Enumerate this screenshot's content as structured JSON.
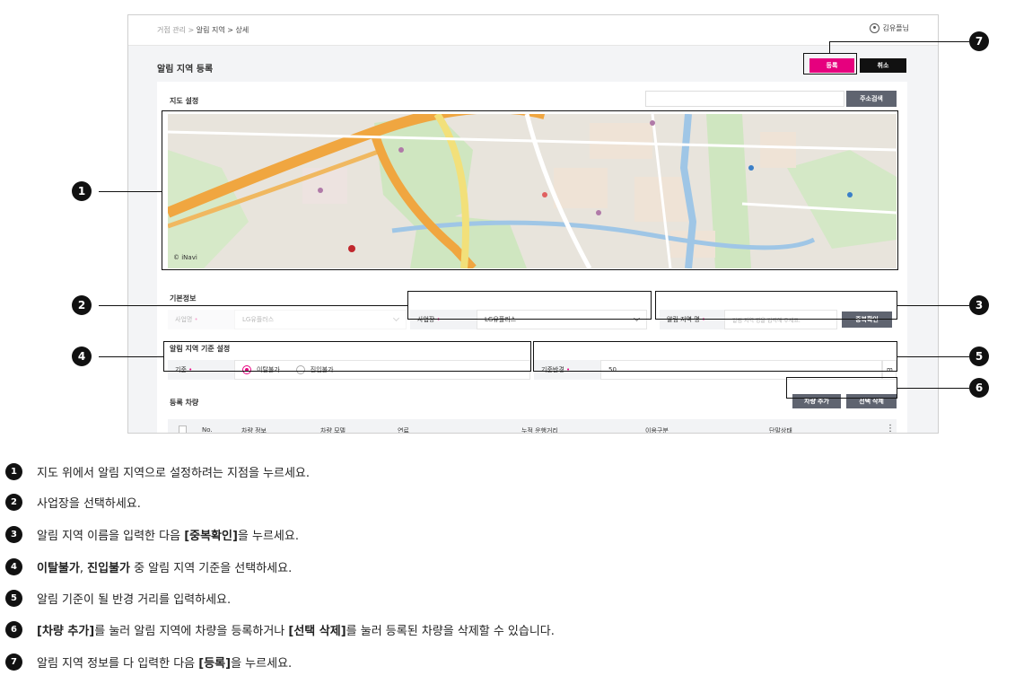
{
  "breadcrumb": {
    "root": "거점 관리",
    "sep": ">",
    "current": "알림 지역 > 상세"
  },
  "user": {
    "name": "김유플님",
    "icon": "user-circle-icon"
  },
  "header": {
    "title": "알림 지역 등록",
    "register_label": "등록",
    "cancel_label": "취소"
  },
  "map_section": {
    "label": "지도 설정",
    "address_search_label": "주소검색",
    "map_brand": "© iNavi"
  },
  "basic_info": {
    "label": "기본정보",
    "company_label": "사업명",
    "company_value": "LG유플러스",
    "workplace_label": "사업장",
    "workplace_value": "LG유플러스",
    "zone_name_label": "알림 지역 명",
    "zone_name_placeholder": "알림 지역 명을 입력해 주세요.",
    "dup_check_label": "중복확인"
  },
  "criteria": {
    "label": "알림 지역 기준 설정",
    "basis_label": "기준",
    "option_exit": "이탈불가",
    "option_entry": "진입불가",
    "selected": "이탈불가",
    "radius_label": "기준반경",
    "radius_value": "50",
    "radius_unit": "m"
  },
  "vehicles": {
    "label": "등록 차량",
    "add_label": "차량 추가",
    "delete_label": "선택 삭제",
    "columns": [
      "No.",
      "차량 정보",
      "차량 모델",
      "연료",
      "누적 운행거리",
      "이용구분",
      "단말상태"
    ]
  },
  "callouts": [
    "1",
    "2",
    "3",
    "4",
    "5",
    "6",
    "7"
  ],
  "steps": [
    {
      "num": "1",
      "parts": [
        {
          "t": "지도 위에서 알림 지역으로 설정하려는 지점을 누르세요.",
          "b": false
        }
      ]
    },
    {
      "num": "2",
      "parts": [
        {
          "t": "사업장을 선택하세요.",
          "b": false
        }
      ]
    },
    {
      "num": "3",
      "parts": [
        {
          "t": "알림 지역 이름을 입력한 다음 ",
          "b": false
        },
        {
          "t": "[중복확인]",
          "b": true
        },
        {
          "t": "을 누르세요.",
          "b": false
        }
      ]
    },
    {
      "num": "4",
      "parts": [
        {
          "t": "이탈불가",
          "b": true
        },
        {
          "t": ", ",
          "b": false
        },
        {
          "t": "진입불가",
          "b": true
        },
        {
          "t": " 중 알림 지역 기준을 선택하세요.",
          "b": false
        }
      ]
    },
    {
      "num": "5",
      "parts": [
        {
          "t": "알림 기준이 될 반경 거리를 입력하세요.",
          "b": false
        }
      ]
    },
    {
      "num": "6",
      "parts": [
        {
          "t": "[차량 추가]",
          "b": true
        },
        {
          "t": "를 눌러 알림 지역에 차량을 등록하거나 ",
          "b": false
        },
        {
          "t": "[선택 삭제]",
          "b": true
        },
        {
          "t": "를 눌러 등록된 차량을 삭제할 수 있습니다.",
          "b": false
        }
      ]
    },
    {
      "num": "7",
      "parts": [
        {
          "t": "알림 지역 정보를 다 입력한 다음 ",
          "b": false
        },
        {
          "t": "[등록]",
          "b": true
        },
        {
          "t": "을 누르세요.",
          "b": false
        }
      ]
    }
  ],
  "colors": {
    "accent": "#e6007e",
    "dark_button": "#5f6470",
    "black": "#111111"
  }
}
